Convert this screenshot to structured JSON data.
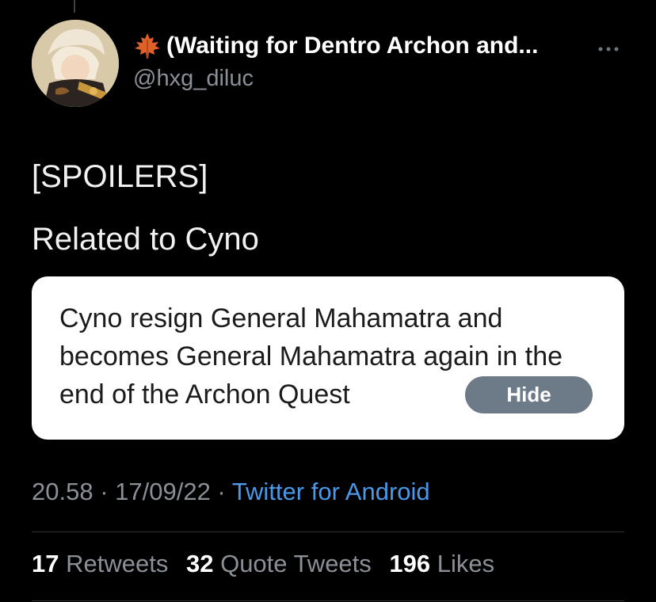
{
  "header": {
    "display_name": "(Waiting for Dentro Archon and...",
    "handle": "@hxg_diluc",
    "name_emoji_icon": "maple-leaf-icon",
    "avatar_icon": "user-avatar",
    "more_icon": "more-options-icon"
  },
  "tweet": {
    "line1": "[SPOILERS]",
    "line2": "Related to Cyno"
  },
  "note": {
    "line1": "Cyno resign General Mahamatra and",
    "line2": "becomes General Mahamatra again in the",
    "line3": "end of the Archon Quest",
    "hide_label": "Hide"
  },
  "meta": {
    "time": "20.58",
    "sep1": " · ",
    "date": "17/09/22",
    "sep2": " · ",
    "source": "Twitter for Android"
  },
  "stats": {
    "retweets_count": "17",
    "retweets_label": "Retweets",
    "quotes_count": "32",
    "quotes_label": "Quote Tweets",
    "likes_count": "196",
    "likes_label": "Likes"
  },
  "colors": {
    "background": "#000000",
    "link": "#4a99e9",
    "muted": "#8b9097",
    "hide_button": "#6d7b89"
  }
}
